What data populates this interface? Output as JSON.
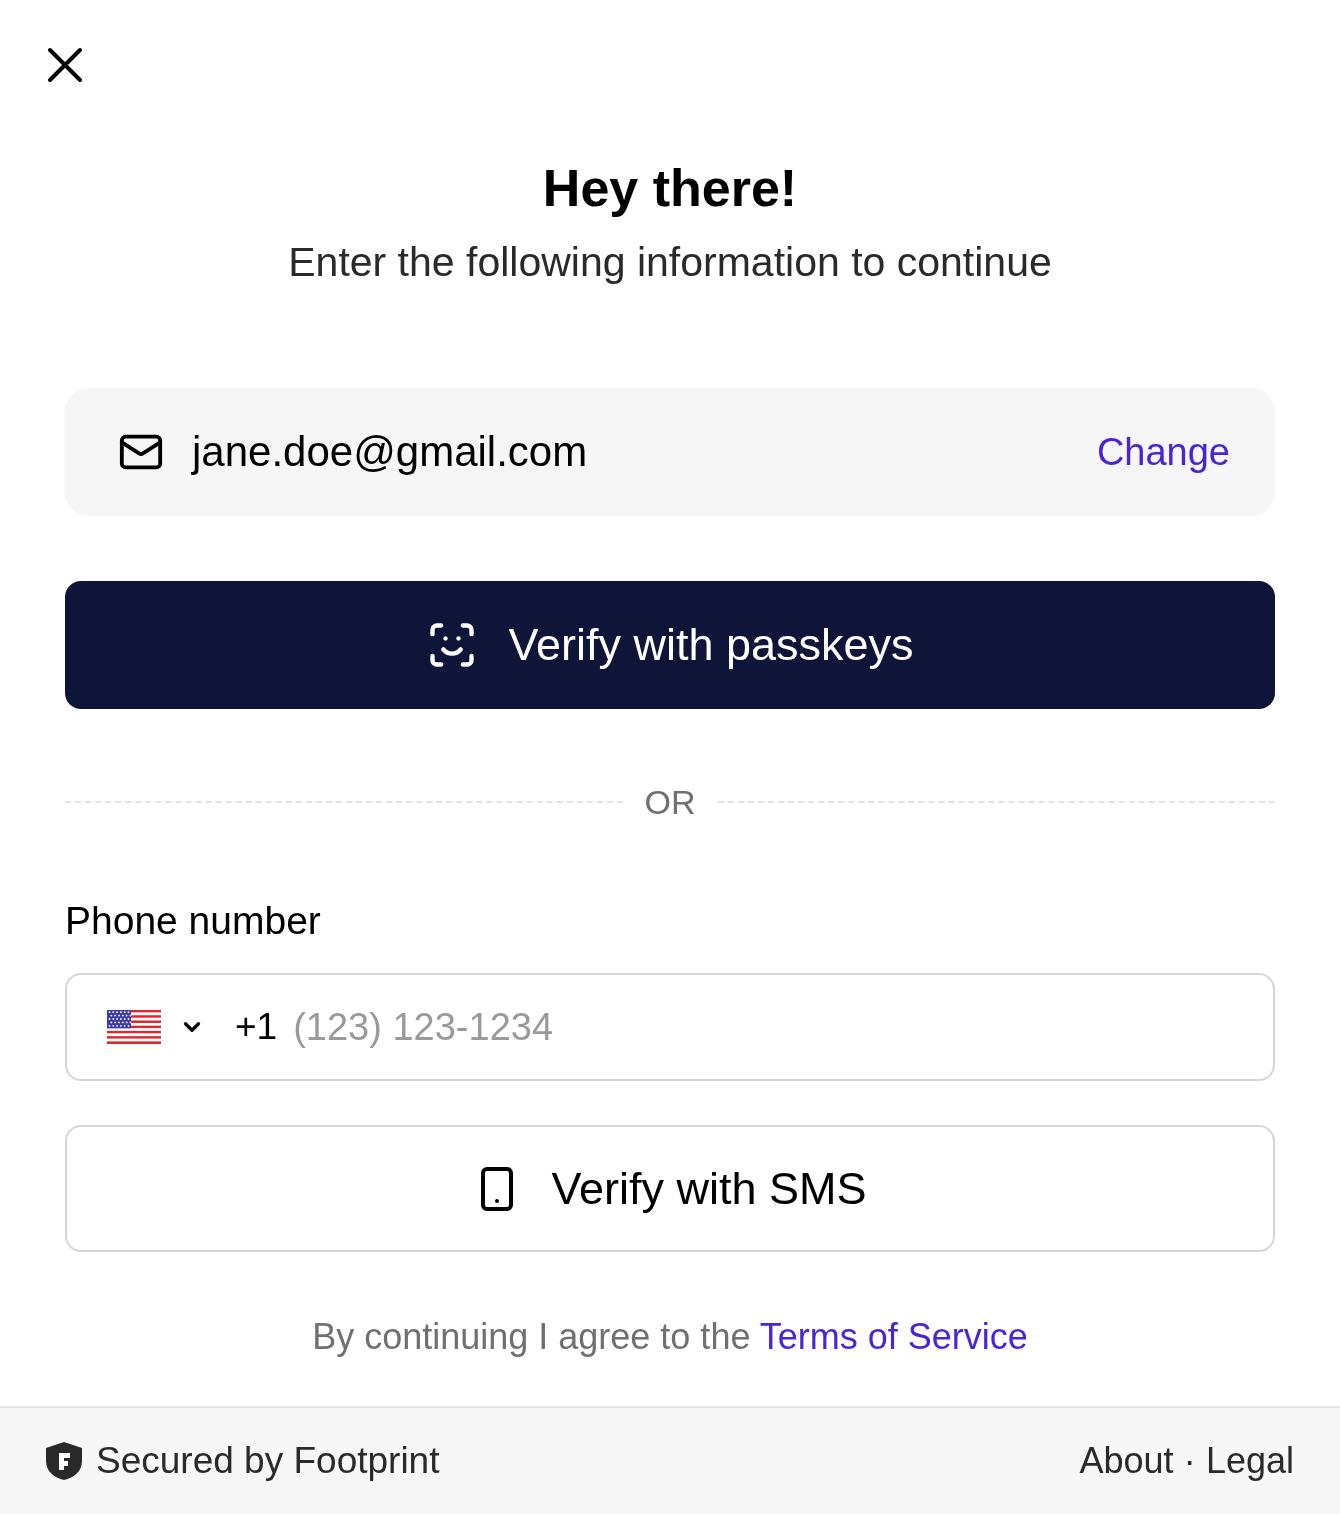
{
  "header": {
    "title": "Hey there!",
    "subtitle": "Enter the following information to continue"
  },
  "email_card": {
    "email": "jane.doe@gmail.com",
    "action": "Change"
  },
  "passkey_button": {
    "label": "Verify with passkeys"
  },
  "divider": {
    "label": "OR"
  },
  "phone": {
    "label": "Phone number",
    "country_code": "+1",
    "placeholder": "(123) 123-1234"
  },
  "sms_button": {
    "label": "Verify with SMS"
  },
  "terms": {
    "text": "By continuing I agree to the",
    "link": "Terms of Service"
  },
  "footer": {
    "brand": "Secured by Footprint",
    "links": [
      "About",
      "Legal"
    ],
    "separator": "·"
  }
}
